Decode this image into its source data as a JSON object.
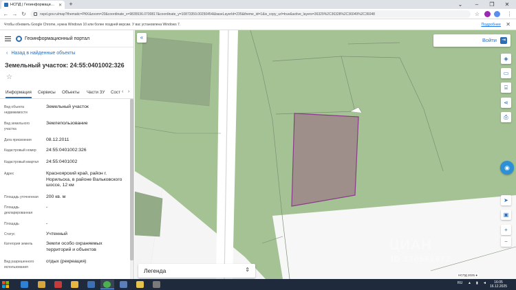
{
  "browser": {
    "tab_title": "НСПД | Геоинформационный портал",
    "url": "nspd.gov.ru/map?thematic=PKK&zoom=20&coordinate_x=9835536.0700817&coordinate_y=10873359.00250454&baseLayerId=235&theme_id=1&is_copy_url=true&active_layers=36329%2C36328%2C36049%2C36048",
    "infobar_message": "Чтобы обновить Google Chrome, нужна Windows 10 или более поздней версии. У вас установлена Windows 7.",
    "infobar_link": "Подробнее"
  },
  "panel": {
    "portal_name": "Геоинформационный портал",
    "back_label": "Назад в найденные объекты",
    "title": "Земельный участок: 24:55:0401002:326",
    "tabs": [
      "Информация",
      "Сервисы",
      "Объекты",
      "Части ЗУ",
      "Сост"
    ],
    "rows": [
      {
        "label": "Вид объекта недвижимости",
        "value": "Земельный участок"
      },
      {
        "label": "Вид земельного участка",
        "value": "Землепользование"
      },
      {
        "label": "Дата присвоения",
        "value": "08.12.2011"
      },
      {
        "label": "Кадастровый номер",
        "value": "24:55:0401002:326"
      },
      {
        "label": "Кадастровый квартал",
        "value": "24:55:0401002"
      },
      {
        "label": "Адрес",
        "value": "Красноярский край, район г. Норильска, в районе Вальковского шоссе, 12 км"
      },
      {
        "label": "Площадь уточненная",
        "value": "200 кв. м"
      },
      {
        "label": "Площадь декларированная",
        "value": "-"
      },
      {
        "label": "Площадь",
        "value": "-"
      },
      {
        "label": "Статус",
        "value": "Учтенный"
      },
      {
        "label": "Категория земель",
        "value": "Земли особо охраняемых территорий и объектов"
      },
      {
        "label": "Вид разрешенного использования",
        "value": "отдых (рекреация)"
      }
    ]
  },
  "map": {
    "login_label": "Войти",
    "legend_label": "Легенда",
    "watermark": "ЦИАН",
    "watermark_id": "ID 330568672",
    "scale_text": "НСПД 2025 ●"
  },
  "taskbar": {
    "lang": "RU",
    "time": "16:05",
    "date": "16.12.2025"
  },
  "colors": {
    "accent": "#2d6db4",
    "map_green": "#a4c294",
    "parcel_fill": "#9e8f8a",
    "parcel_border": "#8b3a8b"
  }
}
